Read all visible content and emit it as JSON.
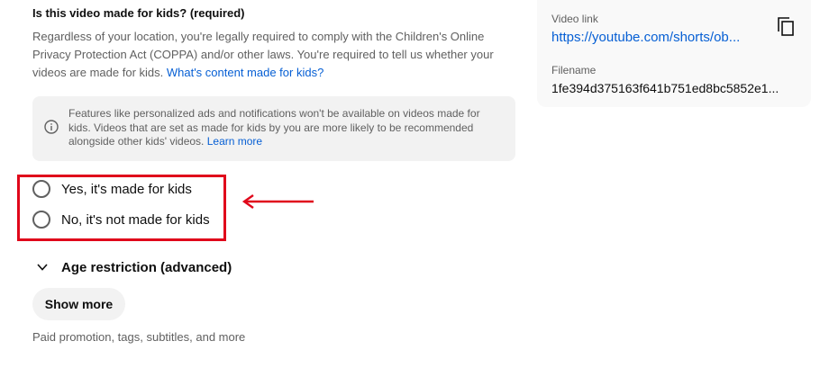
{
  "kids": {
    "question": "Is this video made for kids? (required)",
    "description": "Regardless of your location, you're legally required to comply with the Children's Online Privacy Protection Act (COPPA) and/or other laws. You're required to tell us whether your videos are made for kids.",
    "description_link": "What's content made for kids?",
    "info_text": "Features like personalized ads and notifications won't be available on videos made for kids. Videos that are set as made for kids by you are more likely to be recommended alongside other kids' videos.",
    "info_link": "Learn more",
    "options": [
      {
        "label": "Yes, it's made for kids",
        "selected": false
      },
      {
        "label": "No, it's not made for kids",
        "selected": false
      }
    ]
  },
  "annotation": {
    "highlight_color": "#e0081b",
    "arrow_color": "#e0081b"
  },
  "age_restriction": {
    "label": "Age restriction (advanced)"
  },
  "show_more": {
    "label": "Show more",
    "hint": "Paid promotion, tags, subtitles, and more"
  },
  "side_card": {
    "video_link_label": "Video link",
    "video_link": "https://youtube.com/shorts/ob...",
    "filename_label": "Filename",
    "filename": "1fe394d375163f641b751ed8bc5852e1..."
  },
  "colors": {
    "link": "#065fd4",
    "secondary_text": "#606060",
    "primary_text": "#0f0f0f",
    "surface": "#f2f2f2"
  },
  "icons": {
    "info": "info-icon",
    "copy": "copy-icon",
    "chevron": "chevron-down-icon"
  }
}
